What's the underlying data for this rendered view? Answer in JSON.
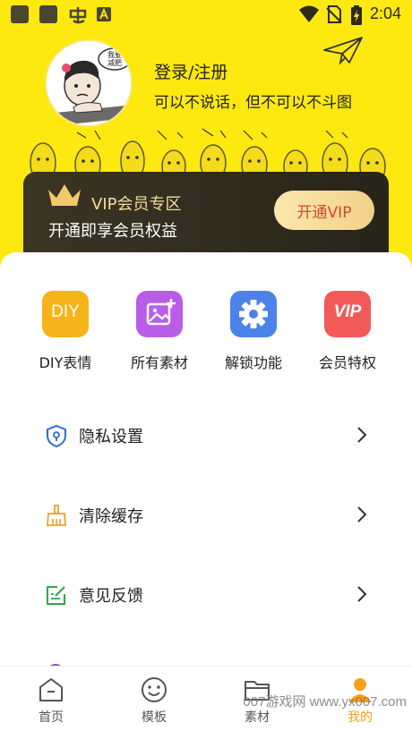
{
  "status_bar": {
    "time": "2:04",
    "notification_icons": [
      "app-square-icon",
      "app-square-icon",
      "chinese-app-icon",
      "a-badge-icon"
    ],
    "system_icons": [
      "wifi-icon",
      "no-sim-icon",
      "battery-charging-icon"
    ]
  },
  "profile": {
    "login_label": "登录/注册",
    "motto": "可以不说话，但不可以不斗图",
    "avatar_caption": "我要减肥"
  },
  "vip_card": {
    "title": "VIP会员专区",
    "subtitle": "开通即享会员权益",
    "button_label": "开通VIP",
    "icon": "crown-icon"
  },
  "quick_actions": [
    {
      "label": "DIY表情",
      "icon_text": "DIY",
      "color": "#f7b31a"
    },
    {
      "label": "所有素材",
      "icon": "image-add-icon",
      "color": "#b95de8"
    },
    {
      "label": "解锁功能",
      "icon": "gear-icon",
      "color": "#4b83e9"
    },
    {
      "label": "会员特权",
      "icon_text": "VIP",
      "color": "#f25a5a"
    }
  ],
  "menu": [
    {
      "label": "隐私设置",
      "icon": "shield-lock-icon"
    },
    {
      "label": "清除缓存",
      "icon": "broom-icon"
    },
    {
      "label": "意见反馈",
      "icon": "feedback-icon"
    }
  ],
  "bottom_nav": [
    {
      "label": "首页",
      "icon": "home-icon"
    },
    {
      "label": "模板",
      "icon": "smiley-icon"
    },
    {
      "label": "素材",
      "icon": "folder-icon"
    },
    {
      "label": "我的",
      "icon": "profile-icon",
      "active": true
    }
  ],
  "watermark": "007游戏网 www.yx007.com",
  "colors": {
    "brand_yellow": "#fde910",
    "vip_dark": "#2f2b1f",
    "vip_gold": "#f2dca0",
    "active_orange": "#f7a11a"
  }
}
